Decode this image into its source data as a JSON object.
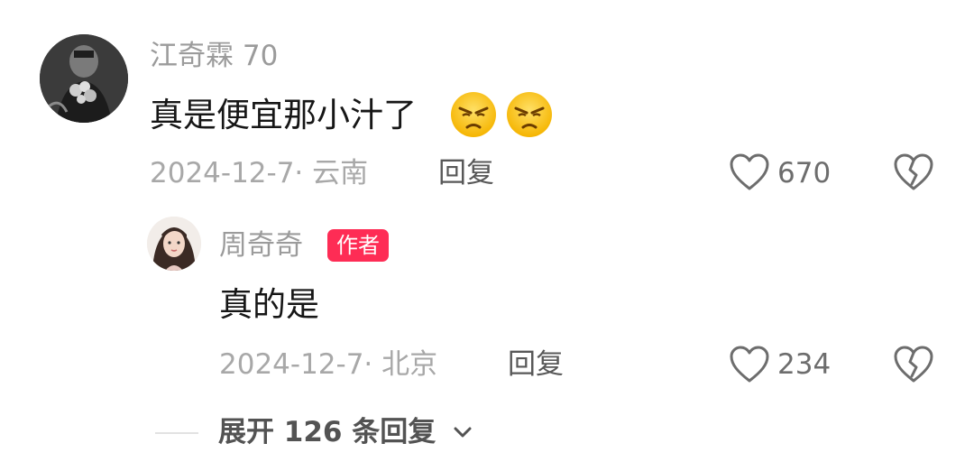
{
  "comment": {
    "username": "江奇霖 70",
    "text": "真是便宜那小汁了",
    "emojis": [
      "angry-face-icon",
      "angry-face-icon"
    ],
    "date_location": "2024-12-7· 云南",
    "reply_label": "回复",
    "like_count": "670"
  },
  "reply": {
    "username": "周奇奇",
    "badge": "作者",
    "text": "真的是",
    "date_location": "2024-12-7· 北京",
    "reply_label": "回复",
    "like_count": "234"
  },
  "expand_replies": {
    "label": "展开 126 条回复"
  },
  "colors": {
    "author_badge": "#fe2c55",
    "username": "#9b9b9b",
    "text": "#161616"
  }
}
